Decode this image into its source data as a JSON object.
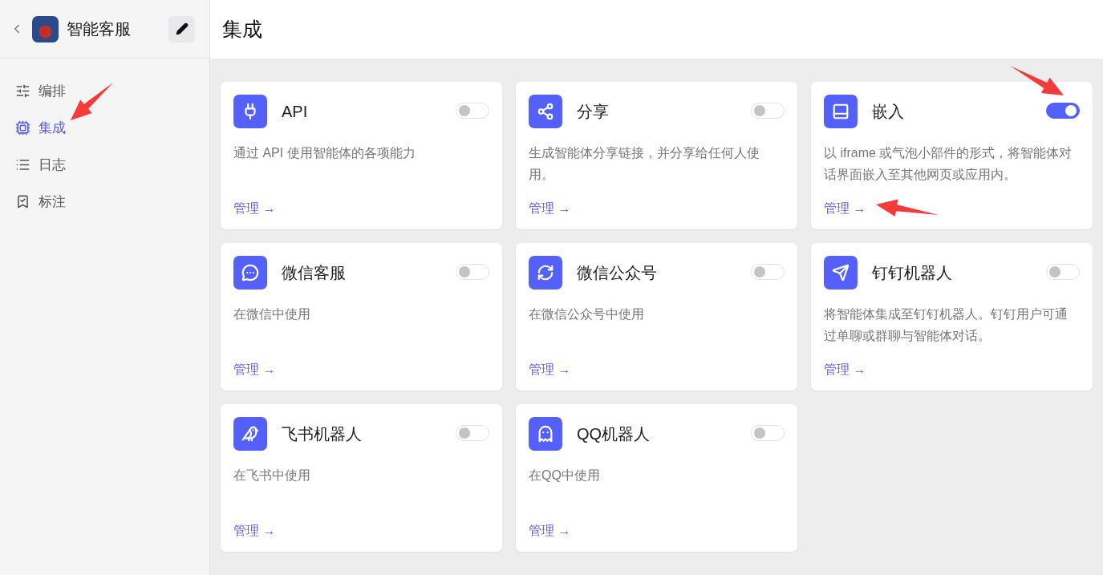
{
  "sidebar": {
    "app_name": "智能客服",
    "items": [
      {
        "label": "编排",
        "kind": "sliders",
        "selected": false
      },
      {
        "label": "集成",
        "kind": "chip",
        "selected": true
      },
      {
        "label": "日志",
        "kind": "list",
        "selected": false
      },
      {
        "label": "标注",
        "kind": "bookmark",
        "selected": false
      }
    ]
  },
  "page_title": "集成",
  "integrations": [
    {
      "kind": "api",
      "name": "API",
      "description": "通过 API 使用智能体的各项能力",
      "enabled": false,
      "link": "管理 →"
    },
    {
      "kind": "share",
      "name": "分享",
      "description": "生成智能体分享链接，并分享给任何人使用。",
      "enabled": false,
      "link": "管理 →"
    },
    {
      "kind": "embed",
      "name": "嵌入",
      "description": "以 iframe 或气泡小部件的形式，将智能体对话界面嵌入至其他网页或应用内。",
      "enabled": true,
      "link": "管理 →"
    },
    {
      "kind": "wechat_service",
      "name": "微信客服",
      "description": "在微信中使用",
      "enabled": false,
      "link": "管理 →"
    },
    {
      "kind": "wechat_official",
      "name": "微信公众号",
      "description": "在微信公众号中使用",
      "enabled": false,
      "link": "管理 →"
    },
    {
      "kind": "dingtalk",
      "name": "钉钉机器人",
      "description": "将智能体集成至钉钉机器人。钉钉用户可通过单聊或群聊与智能体对话。",
      "enabled": false,
      "link": "管理 →"
    },
    {
      "kind": "feishu",
      "name": "飞书机器人",
      "description": "在飞书中使用",
      "enabled": false,
      "link": "管理 →"
    },
    {
      "kind": "qq",
      "name": "QQ机器人",
      "description": "在QQ中使用",
      "enabled": false,
      "link": "管理 →"
    }
  ]
}
